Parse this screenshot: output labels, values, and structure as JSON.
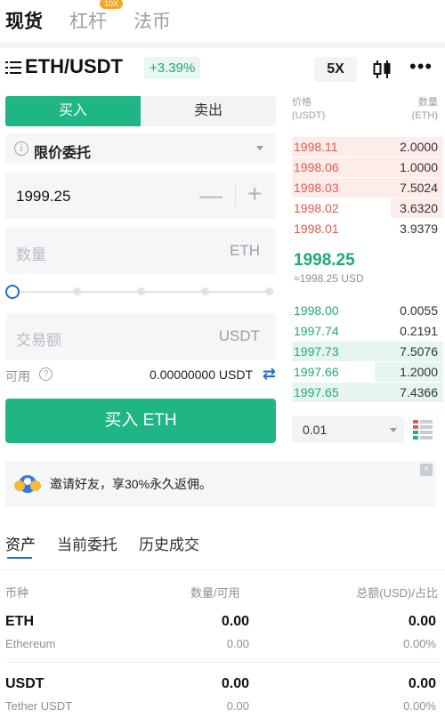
{
  "top_tabs": [
    {
      "label": "现货"
    },
    {
      "label": "杠杆",
      "badge": "10X"
    },
    {
      "label": "法币"
    }
  ],
  "pair": {
    "name": "ETH/USDT",
    "change": "+3.39%",
    "leverage": "5X"
  },
  "order_form": {
    "buy_label": "买入",
    "sell_label": "卖出",
    "order_type": "限价委托",
    "price_value": "1999.25",
    "minus": "—",
    "plus": "+",
    "amount_placeholder": "数量",
    "amount_unit": "ETH",
    "total_placeholder": "交易额",
    "total_unit": "USDT",
    "available_label": "可用",
    "available_value": "0.00000000 USDT",
    "submit_label": "买入 ETH",
    "slider_percent": 0
  },
  "order_book": {
    "price_header": "价格",
    "price_unit": "(USDT)",
    "qty_header": "数量",
    "qty_unit": "(ETH)",
    "asks": [
      {
        "price": "1998.11",
        "qty": "2.0000",
        "depth": 1.0
      },
      {
        "price": "1998.06",
        "qty": "1.0000",
        "depth": 1.0
      },
      {
        "price": "1998.03",
        "qty": "7.5024",
        "depth": 1.0
      },
      {
        "price": "1998.02",
        "qty": "3.6320",
        "depth": 0.35
      },
      {
        "price": "1998.01",
        "qty": "3.9379",
        "depth": 0.0
      }
    ],
    "last_price": "1998.25",
    "last_usd": "≈1998.25 USD",
    "bids": [
      {
        "price": "1998.00",
        "qty": "0.0055",
        "depth": 0.0
      },
      {
        "price": "1997.74",
        "qty": "0.2191",
        "depth": 0.0
      },
      {
        "price": "1997.73",
        "qty": "7.5076",
        "depth": 1.0
      },
      {
        "price": "1997.66",
        "qty": "1.2000",
        "depth": 0.45
      },
      {
        "price": "1997.65",
        "qty": "7.4366",
        "depth": 1.0
      }
    ],
    "depth_step": "0.01"
  },
  "banner": {
    "text": "邀请好友，享30%永久返佣。",
    "close": "×"
  },
  "bottom_tabs": [
    {
      "label": "资产"
    },
    {
      "label": "当前委托"
    },
    {
      "label": "历史成交"
    }
  ],
  "assets": {
    "headers": {
      "coin": "币种",
      "qty": "数量/可用",
      "total": "总额(USD)/占比"
    },
    "rows": [
      {
        "symbol": "ETH",
        "name": "Ethereum",
        "amount": "0.00",
        "available": "0.00",
        "total": "0.00",
        "percent": "0.00%"
      },
      {
        "symbol": "USDT",
        "name": "Tether USDT",
        "amount": "0.00",
        "available": "0.00",
        "total": "0.00",
        "percent": "0.00%"
      }
    ]
  },
  "colors": {
    "buy_green": "#1fb585",
    "ask_red": "#e2594f",
    "accent_blue": "#1f6fd0"
  }
}
